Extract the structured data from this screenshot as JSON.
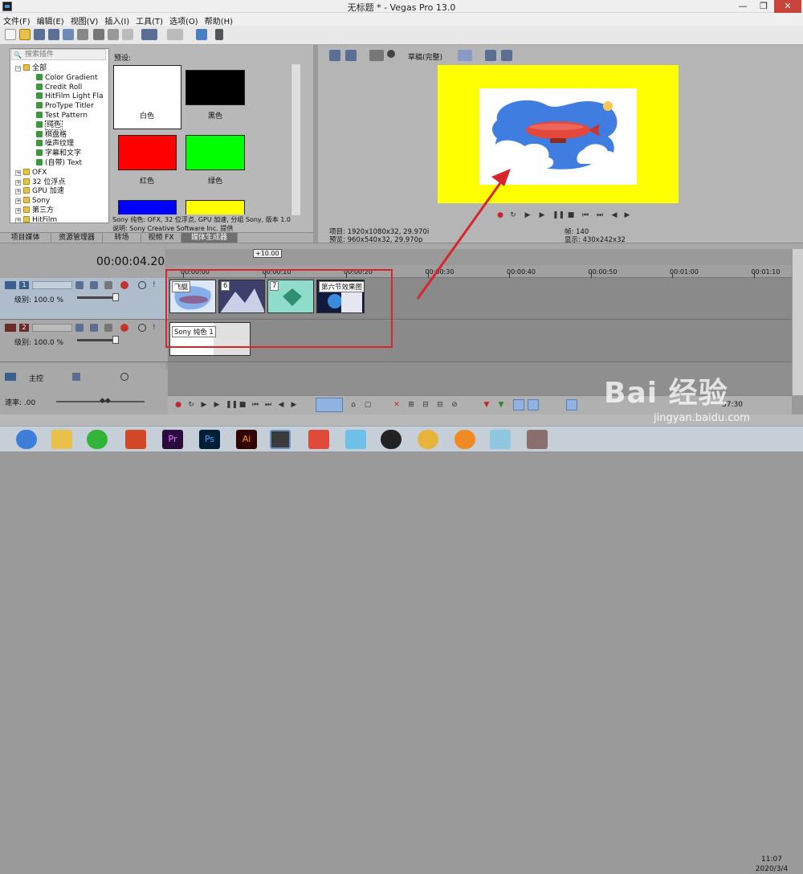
{
  "window": {
    "title": "无标题 * - Vegas Pro 13.0",
    "minimize": "—",
    "maximize": "❐",
    "close": "✕"
  },
  "menu": [
    "文件(F)",
    "编辑(E)",
    "视图(V)",
    "插入(I)",
    "工具(T)",
    "选项(O)",
    "帮助(H)"
  ],
  "plugins": {
    "search_placeholder": "搜索插件",
    "tree": [
      {
        "label": "全部",
        "kind": "folder"
      },
      {
        "label": "Color Gradient",
        "kind": "fx"
      },
      {
        "label": "Credit Roll",
        "kind": "fx"
      },
      {
        "label": "HitFilm Light Fla",
        "kind": "fx"
      },
      {
        "label": "ProType Titler",
        "kind": "fx"
      },
      {
        "label": "Test Pattern",
        "kind": "fx"
      },
      {
        "label": "纯色",
        "kind": "fx"
      },
      {
        "label": "棋盘格",
        "kind": "fx"
      },
      {
        "label": "噪声纹理",
        "kind": "fx"
      },
      {
        "label": "字幕和文字",
        "kind": "fx"
      },
      {
        "label": "(自带) Text",
        "kind": "fx"
      },
      {
        "label": "OFX",
        "kind": "folder"
      },
      {
        "label": "32 位浮点",
        "kind": "folder"
      },
      {
        "label": "GPU 加速",
        "kind": "folder"
      },
      {
        "label": "Sony",
        "kind": "folder"
      },
      {
        "label": "第三方",
        "kind": "folder"
      },
      {
        "label": "HitFilm",
        "kind": "folder"
      }
    ]
  },
  "presets": {
    "label": "预设:",
    "items": [
      {
        "name": "白色",
        "color": "#ffffff"
      },
      {
        "name": "黑色",
        "color": "#000000"
      },
      {
        "name": "红色",
        "color": "#ff0000"
      },
      {
        "name": "绿色",
        "color": "#00ff00"
      },
      {
        "name": "",
        "color": "#0000ff"
      },
      {
        "name": "",
        "color": "#ffff00"
      }
    ],
    "desc1": "Sony 纯色: OFX, 32 位浮点, GPU 加速, 分组 Sony, 版本 1.0",
    "desc2": "说明: Sony Creative Software Inc. 提供"
  },
  "tabs": [
    "项目媒体",
    "资源管理器",
    "转场",
    "视频 FX",
    "媒体生成器"
  ],
  "preview": {
    "quality": "草稿(完整)",
    "bg_color": "#ffff00",
    "project": "项目: 1920x1080x32, 29.970i",
    "preview": "预览: 960x540x32, 29.970p",
    "frame": "帧:    140",
    "display": "显示: 430x242x32"
  },
  "timeline": {
    "timecode": "00:00:04.20",
    "loop_value": "+10.00",
    "ruler": [
      "00:00:00",
      "00:00:10",
      "00:00:20",
      "00:00:30",
      "00:00:40",
      "00:00:50",
      "00:01:00",
      "00:01:10"
    ],
    "track1": {
      "num": "1",
      "level": "级别: 100.0 %"
    },
    "track2": {
      "num": "2",
      "level": "级别: 100.0 %"
    },
    "master": "主控",
    "speed": "速率: .00",
    "clips": [
      {
        "name": "飞艇"
      },
      {
        "name": "6"
      },
      {
        "name": "7"
      },
      {
        "name": "第六节效果图"
      }
    ],
    "solid_clip": "Sony 纯色 1",
    "end_time": "57:30"
  },
  "taskbar": {
    "time": "11:07",
    "date": "2020/3/4"
  },
  "watermark": {
    "brand": "Bai 经验",
    "url": "jingyan.baidu.com"
  }
}
